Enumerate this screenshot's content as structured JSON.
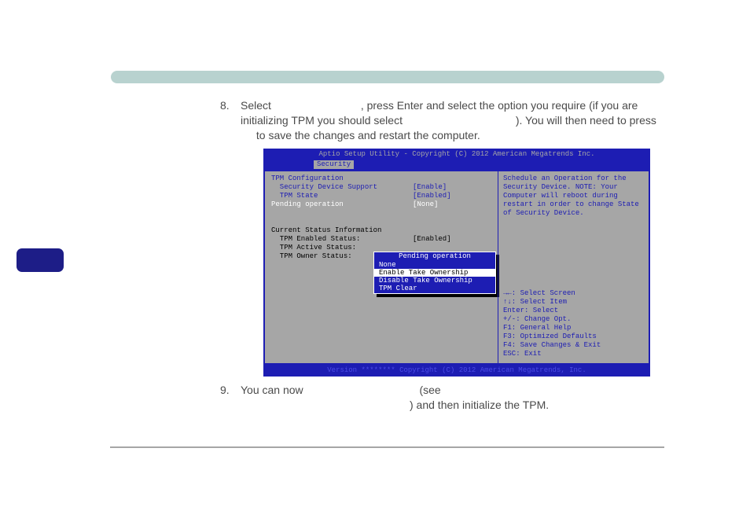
{
  "step8": {
    "number": "8.",
    "t1": "Select ",
    "t2": ", press Enter and select the option you require (if you are initializing TPM you should select ",
    "t3": "). You will then need to press ",
    "t4": " to save the changes and restart the computer."
  },
  "bios": {
    "title": "Aptio Setup Utility - Copyright (C) 2012 American Megatrends Inc.",
    "tab": "Security",
    "footer": "Version ******** Copyright (C) 2012 American Megatrends, Inc.",
    "left": {
      "h1": "TPM Configuration",
      "r1l": "  Security Device Support",
      "r1v": "[Enable]",
      "r2l": "  TPM State",
      "r2v": "[Enabled]",
      "r3l": "Pending operation",
      "r3v": "[None]",
      "h2": "Current Status Information",
      "r4l": "  TPM Enabled Status:",
      "r4v": "[Enabled]",
      "r5l": "  TPM Active Status:",
      "r6l": "  TPM Owner Status:"
    },
    "popup": {
      "title": "Pending operation",
      "o1": "None",
      "o2": "Enable Take Ownership",
      "o3": "Disable Take Ownership",
      "o4": "TPM Clear"
    },
    "desc": "Schedule an Operation for the Security Device. NOTE: Your Computer will reboot during restart in order to change State of Security Device.",
    "help": {
      "k1": "→←: Select Screen",
      "k2": "↑↓: Select Item",
      "k3": "Enter: Select",
      "k4": "+/-: Change Opt.",
      "k5": "F1: General Help",
      "k6": "F3: Optimized Defaults",
      "k7": "F4: Save Changes & Exit",
      "k8": "ESC: Exit"
    }
  },
  "step9": {
    "number": "9.",
    "t1": "You can now ",
    "t2": " (see ",
    "t3": ") and then initialize the TPM."
  }
}
